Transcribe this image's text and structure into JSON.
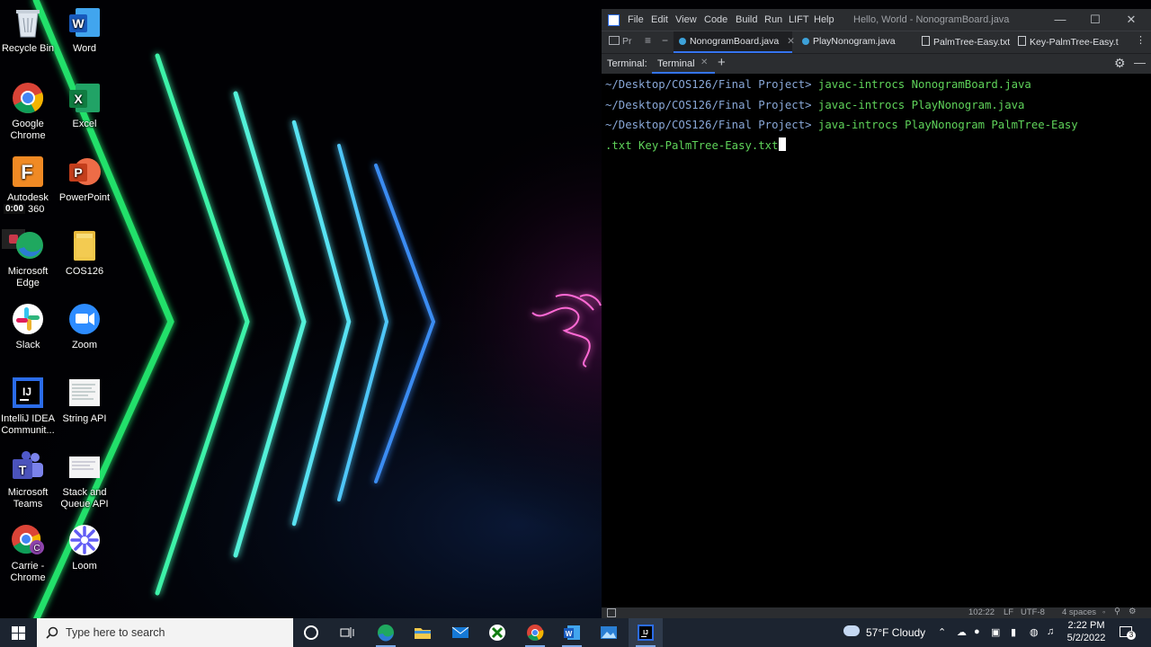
{
  "desktop": {
    "icons": [
      {
        "label": "Recycle Bin",
        "icon": "recycle-bin-icon"
      },
      {
        "label": "Word",
        "icon": "word-icon"
      },
      {
        "label": "Google Chrome",
        "icon": "chrome-icon"
      },
      {
        "label": "Excel",
        "icon": "excel-icon"
      },
      {
        "label": "Autodesk ...n 360",
        "icon": "autodesk-fusion-icon"
      },
      {
        "label": "PowerPoint",
        "icon": "powerpoint-icon"
      },
      {
        "label": "Microsoft Edge",
        "icon": "edge-icon"
      },
      {
        "label": "COS126",
        "icon": "folder-icon"
      },
      {
        "label": "Slack",
        "icon": "slack-icon"
      },
      {
        "label": "Zoom",
        "icon": "zoom-icon"
      },
      {
        "label": "IntelliJ IDEA Communit...",
        "icon": "intellij-icon"
      },
      {
        "label": "String API",
        "icon": "document-thumbnail-icon"
      },
      {
        "label": "Microsoft Teams",
        "icon": "teams-icon"
      },
      {
        "label": "Stack and Queue API",
        "icon": "document-thumbnail-icon"
      },
      {
        "label": "Carrie - Chrome",
        "icon": "chrome-profile-icon"
      },
      {
        "label": "Loom",
        "icon": "loom-icon"
      }
    ],
    "recording_timer": "0:00"
  },
  "ide": {
    "menu": [
      "File",
      "Edit",
      "View",
      "Code",
      "Build",
      "Run",
      "LIFT",
      "Help"
    ],
    "title": "Hello, World - NonogramBoard.java",
    "project_label": "Pr",
    "tabs": [
      {
        "label": "NonogramBoard.java",
        "active": true
      },
      {
        "label": "PlayNonogram.java",
        "active": false
      },
      {
        "label": "PalmTree-Easy.txt",
        "active": false
      },
      {
        "label": "Key-PalmTree-Easy.t",
        "active": false
      }
    ],
    "terminal": {
      "header_label": "Terminal:",
      "tab_label": "Terminal",
      "lines": [
        {
          "prompt": "~/Desktop/COS126/Final Project> ",
          "command": "javac-introcs NonogramBoard.java"
        },
        {
          "prompt": "~/Desktop/COS126/Final Project> ",
          "command": "javac-introcs PlayNonogram.java"
        },
        {
          "prompt": "~/Desktop/COS126/Final Project> ",
          "command": "java-introcs PlayNonogram PalmTree-Easy"
        },
        {
          "prompt": "",
          "command": ".txt Key-PalmTree-Easy.txt"
        }
      ]
    },
    "status": {
      "position": "102:22",
      "line_ending": "LF",
      "encoding": "UTF-8",
      "indent": "4 spaces"
    }
  },
  "taskbar": {
    "search_placeholder": "Type here to search",
    "weather": "57°F  Cloudy",
    "time": "2:22 PM",
    "date": "5/2/2022",
    "notification_count": "3"
  },
  "colors": {
    "terminal_command": "#5fd35a",
    "terminal_prompt": "#89a8d8",
    "taskbar": "#1c2430",
    "ide_chrome": "#2b2d30"
  }
}
